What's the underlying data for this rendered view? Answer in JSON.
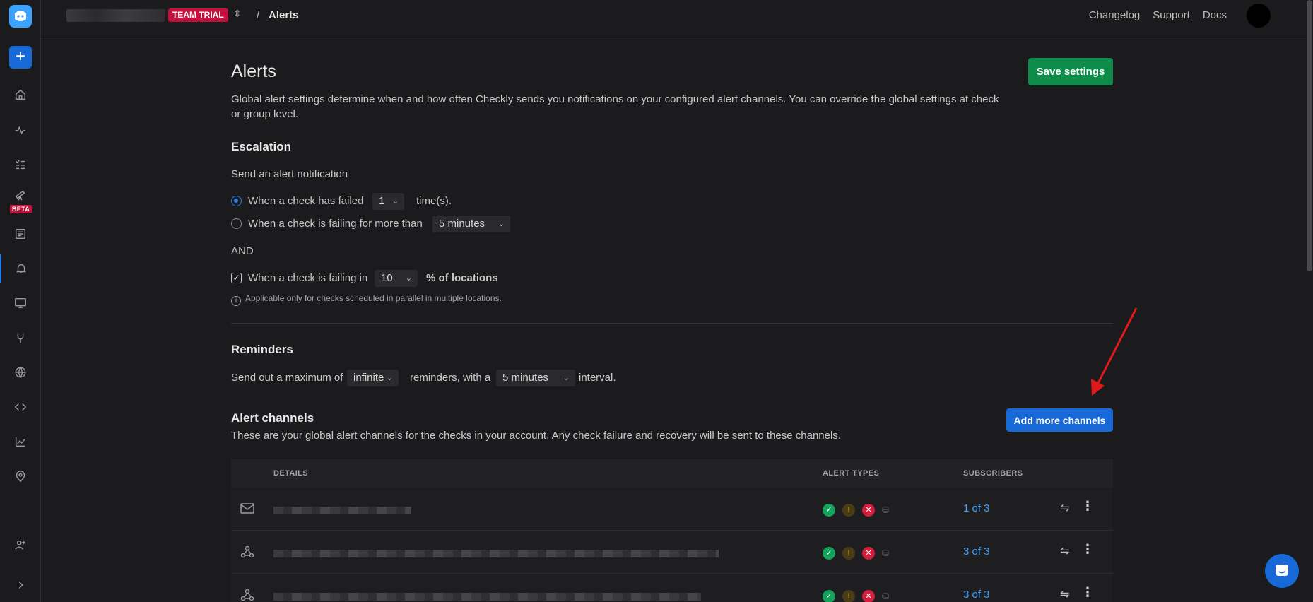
{
  "topbar": {
    "badge": "TEAM TRIAL",
    "breadcrumb_sep": "/",
    "page": "Alerts",
    "links": [
      "Changelog",
      "Support",
      "Docs"
    ]
  },
  "sidebar": {
    "beta_label": "BETA",
    "items": [
      "home-icon",
      "activity-icon",
      "checks-list-icon",
      "telescope-icon",
      "test-sessions-icon",
      "alerts-bell-icon",
      "dashboard-monitor-icon",
      "maintenance-icon",
      "globe-icon",
      "code-icon",
      "chart-icon",
      "location-icon",
      "invite-user-icon",
      "expand-icon"
    ]
  },
  "main": {
    "title": "Alerts",
    "save_label": "Save settings",
    "intro": "Global alert settings determine when and how often Checkly sends you notifications on your configured alert channels. You can override the global settings at check or group level.",
    "escalation": {
      "title": "Escalation",
      "subtitle": "Send an alert notification",
      "opt1_label": "When a check has failed",
      "opt1_value": "1",
      "opt1_suffix": "time(s).",
      "opt2_label": "When a check is failing for more than",
      "opt2_value": "5 minutes",
      "and_label": "AND",
      "loc_label": "When a check is failing in",
      "loc_value": "10",
      "loc_suffix": "% of locations",
      "note": "Applicable only for checks scheduled in parallel in multiple locations."
    },
    "reminders": {
      "title": "Reminders",
      "prefix": "Send out a maximum of",
      "count_value": "infinite",
      "middle": "reminders, with a",
      "interval_value": "5 minutes",
      "suffix": "interval."
    },
    "channels": {
      "title": "Alert channels",
      "subtitle": "These are your global alert channels for the checks in your account. Any check failure and recovery will be sent to these channels.",
      "add_label": "Add more channels",
      "columns": [
        "DETAILS",
        "ALERT TYPES",
        "SUBSCRIBERS"
      ],
      "rows": [
        {
          "type": "email-icon",
          "subscribers": "1 of 3"
        },
        {
          "type": "webhook-icon",
          "subscribers": "3 of 3"
        },
        {
          "type": "webhook-icon",
          "subscribers": "3 of 3"
        }
      ]
    }
  },
  "colors": {
    "accent_blue": "#1769d8",
    "save_green": "#0f8b4a",
    "trial_red": "#c0123c",
    "link_blue": "#3ea0ff",
    "annotation_red": "#e01a1a"
  }
}
